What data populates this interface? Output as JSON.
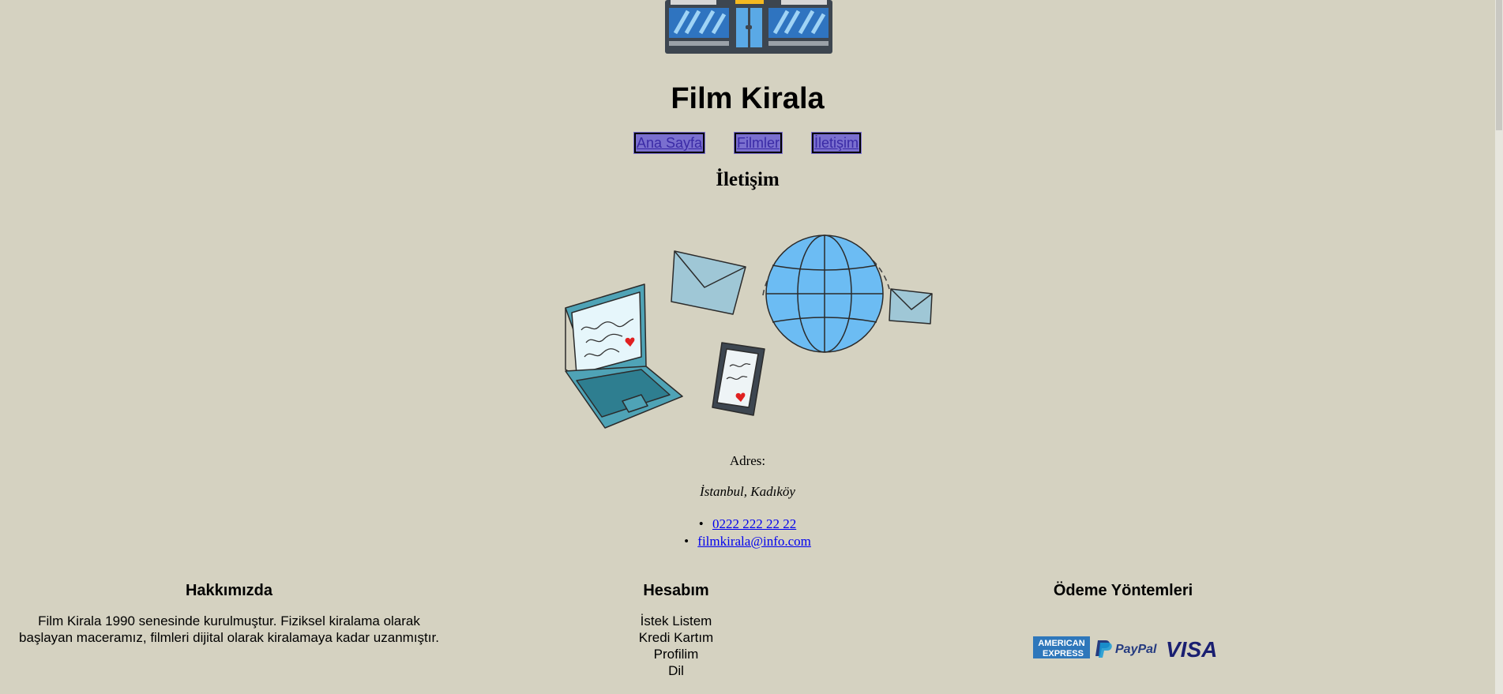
{
  "header": {
    "logo_icon": "cinema-storefront-icon",
    "site_title": "Film Kirala"
  },
  "nav": {
    "items": [
      {
        "label": "Ana Sayfa"
      },
      {
        "label": "Filmler"
      },
      {
        "label": "İletişim"
      }
    ]
  },
  "main": {
    "heading": "İletişim",
    "illustration_icon": "contact-devices-globe-icon",
    "address_label": "Adres:",
    "address_value": "İstanbul, Kadıköy",
    "contacts": [
      {
        "text": "0222 222 22 22"
      },
      {
        "text": "filmkirala@info.com"
      }
    ]
  },
  "footer": {
    "about": {
      "title": "Hakkımızda",
      "text": "Film Kirala 1990 senesinde kurulmuştur. Fiziksel kiralama olarak başlayan maceramız, filmleri dijital olarak kiralamaya kadar uzanmıştır."
    },
    "account": {
      "title": "Hesabım",
      "items": [
        "İstek Listem",
        "Kredi Kartım",
        "Profilim",
        "Dil"
      ]
    },
    "payment": {
      "title": "Ödeme Yöntemleri",
      "logos": [
        "AMERICAN",
        "EXPRESS",
        "PayPal",
        "VISA"
      ]
    }
  },
  "colors": {
    "background": "#d5d2c1",
    "nav_button": "#7a6fcf",
    "link": "#0000ee"
  }
}
